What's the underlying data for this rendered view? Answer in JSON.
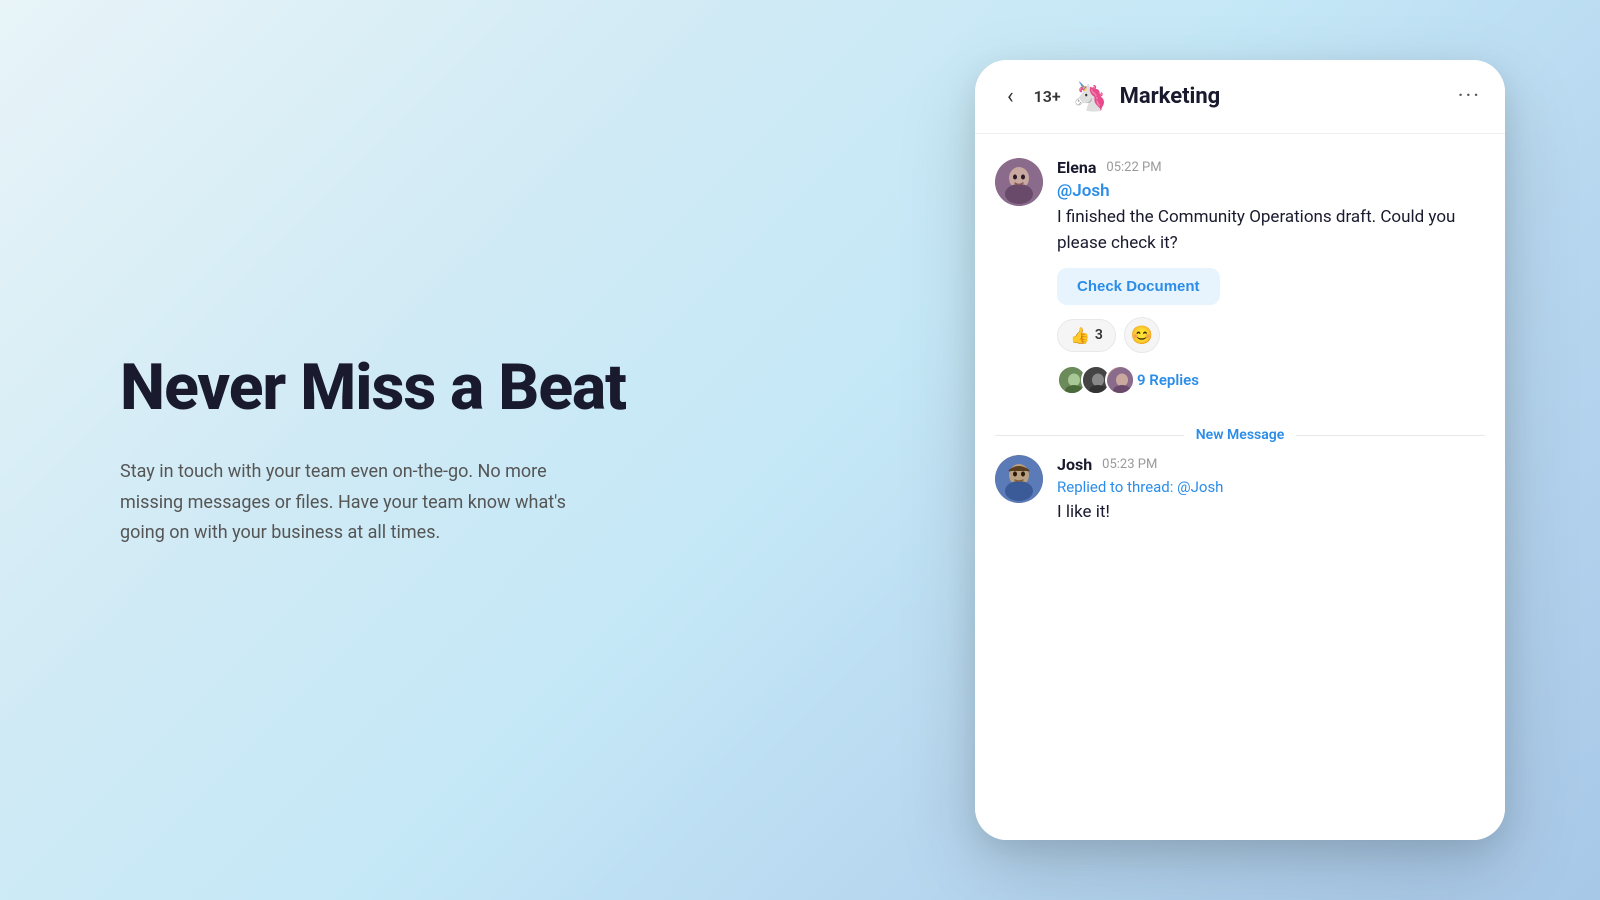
{
  "left": {
    "title": "Never Miss a Beat",
    "subtitle": "Stay in touch with your team even on-the-go. No more missing messages or files. Have your team know what's going on with your business at all times."
  },
  "chat": {
    "header": {
      "back_icon": "‹",
      "member_count": "13+",
      "channel_emoji": "🦄",
      "channel_name": "Marketing",
      "more_icon": "···"
    },
    "messages": [
      {
        "id": "msg1",
        "sender": "Elena",
        "timestamp": "05:22 PM",
        "mention": "@Josh",
        "text": "I finished the Community Operations draft. Could you please check it?",
        "action_button": "Check Document",
        "reaction_emoji": "👍",
        "reaction_count": "3",
        "replies_count": "9 Replies"
      },
      {
        "id": "msg2",
        "sender": "Josh",
        "timestamp": "05:23 PM",
        "replied_to": "Replied to thread:",
        "replied_mention": "@Josh",
        "text": "I like it!"
      }
    ],
    "new_message_label": "New Message"
  }
}
